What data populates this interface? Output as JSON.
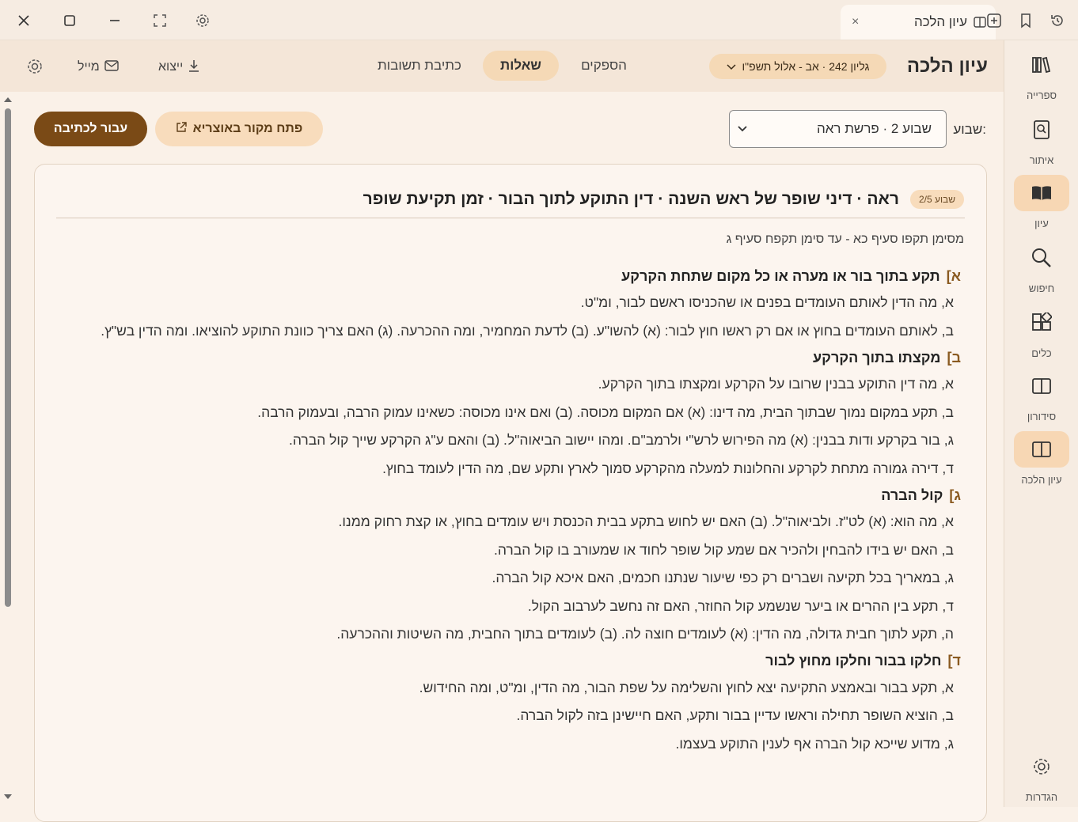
{
  "window": {
    "controls": [
      "close-icon",
      "maximize-icon",
      "minimize-icon",
      "fullscreen-icon",
      "gear-icon"
    ]
  },
  "tab": {
    "label": "עיון הלכה",
    "close": "×"
  },
  "header": {
    "title": "עיון הלכה",
    "issue": "גליון 242 · אב - אלול תשפ\"ו",
    "nav": [
      "הספקים",
      "שאלות",
      "כתיבת תשובות"
    ],
    "active_nav": "שאלות",
    "export_label": "ייצוא",
    "mail_label": "מייל"
  },
  "sidebar": {
    "items": [
      {
        "label": "ספרייה",
        "icon": "library-icon"
      },
      {
        "label": "איתור",
        "icon": "locate-icon"
      },
      {
        "label": "עיון",
        "icon": "book-open-icon"
      },
      {
        "label": "חיפוש",
        "icon": "search-icon"
      },
      {
        "label": "כלים",
        "icon": "tools-icon"
      },
      {
        "label": "סידורון",
        "icon": "siddur-icon"
      },
      {
        "label": "עיון הלכה",
        "icon": "halacha-book-icon"
      }
    ],
    "settings_label": "הגדרות"
  },
  "controls": {
    "week_label": "שבוע:",
    "week_value": "שבוע 2 · פרשת ראה",
    "open_source": "פתח מקור באוצריא",
    "go_write": "עבור לכתיבה"
  },
  "card": {
    "badge": "שבוע 2/5",
    "title": "ראה · דיני שופר של ראש השנה · דין התוקע לתוך הבור · זמן תקיעת שופר",
    "range": "מסימן תקפו סעיף כא - עד סימן תקפח סעיף ג",
    "sections": [
      {
        "letter": "א]",
        "title": "תקע בתוך בור או מערה או כל מקום שתחת הקרקע",
        "items": [
          "א, מה הדין לאותם העומדים בפנים או שהכניסו ראשם לבור, ומ\"ט.",
          "ב, לאותם העומדים בחוץ או אם רק ראשו חוץ לבור: (א) להשו\"ע. (ב) לדעת המחמיר, ומה ההכרעה. (ג) האם צריך כוונת התוקע להוציאו. ומה הדין בש\"ץ."
        ]
      },
      {
        "letter": "ב]",
        "title": "מקצתו בתוך הקרקע",
        "items": [
          "א, מה דין התוקע בבנין שרובו על הקרקע ומקצתו בתוך הקרקע.",
          "ב, תקע במקום נמוך שבתוך הבית, מה דינו: (א) אם המקום מכוסה. (ב) ואם אינו מכוסה: כשאינו עמוק הרבה, ובעמוק הרבה.",
          "ג, בור בקרקע ודות בבנין: (א) מה הפירוש לרש\"י ולרמב\"ם. ומהו יישוב הביאוה\"ל. (ב) והאם ע\"ג הקרקע שייך קול הברה.",
          "ד, דירה גמורה מתחת לקרקע והחלונות למעלה מהקרקע סמוך לארץ ותקע שם, מה הדין לעומד בחוץ."
        ]
      },
      {
        "letter": "ג]",
        "title": "קול הברה",
        "items": [
          "א, מה הוא: (א) לט\"ז. ולביאוה\"ל. (ב) האם יש לחוש בתקע בבית הכנסת ויש עומדים בחוץ, או קצת רחוק ממנו.",
          "ב, האם יש בידו להבחין ולהכיר אם שמע קול שופר לחוד או שמעורב בו קול הברה.",
          "ג, במאריך בכל תקיעה ושברים רק כפי שיעור שנתנו חכמים, האם איכא קול הברה.",
          "ד, תקע בין ההרים או ביער שנשמע קול החוזר, האם זה נחשב לערבוב הקול.",
          "ה, תקע לתוך חבית גדולה, מה הדין: (א) לעומדים חוצה לה. (ב) לעומדים בתוך החבית, מה השיטות וההכרעה."
        ]
      },
      {
        "letter": "ד]",
        "title": "חלקו בבור וחלקו מחוץ לבור",
        "items": [
          "א, תקע בבור ובאמצע התקיעה יצא לחוץ והשלימה על שפת הבור, מה הדין, ומ\"ט, ומה החידוש.",
          "ב, הוציא השופר תחילה וראשו עדיין בבור ותקע, האם חיישינן בזה לקול הברה.",
          "ג, מדוע שייכא קול הברה אף לענין התוקע בעצמו."
        ]
      }
    ]
  },
  "colors": {
    "accent": "#7a4a16",
    "pill": "#f5d9b6",
    "background": "#faf1e8",
    "letter": "#8a5a20"
  }
}
